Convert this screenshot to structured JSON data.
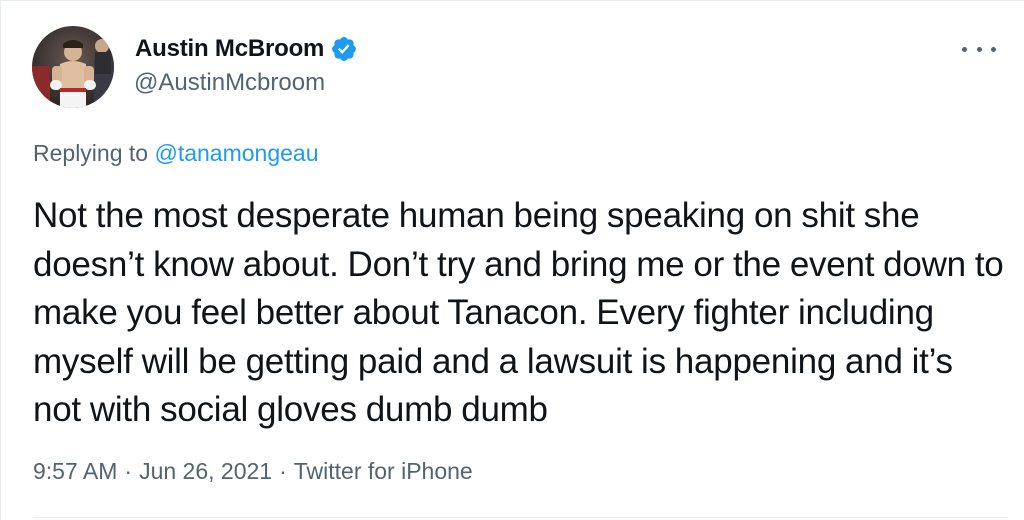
{
  "tweet": {
    "author": {
      "display_name": "Austin McBroom",
      "handle": "@AustinMcbroom",
      "verified": true
    },
    "reply_prefix": "Replying to",
    "reply_to": "@tanamongeau",
    "text": "Not the most desperate human being speaking on shit she doesn’t know about. Don’t try and bring me or the event down to make you feel better about Tanacon. Every fighter including myself will be getting paid and a lawsuit is happening and it’s not with social gloves dumb dumb",
    "time": "9:57 AM",
    "date": "Jun 26, 2021",
    "separator": "·",
    "source": "Twitter for iPhone"
  },
  "icons": {
    "verified": "verified-badge-icon",
    "more": "more-options-icon"
  },
  "colors": {
    "text_primary": "#0f1419",
    "text_secondary": "#536471",
    "link": "#1d9bf0",
    "verified": "#1d9bf0",
    "border": "#e6ecf0"
  }
}
